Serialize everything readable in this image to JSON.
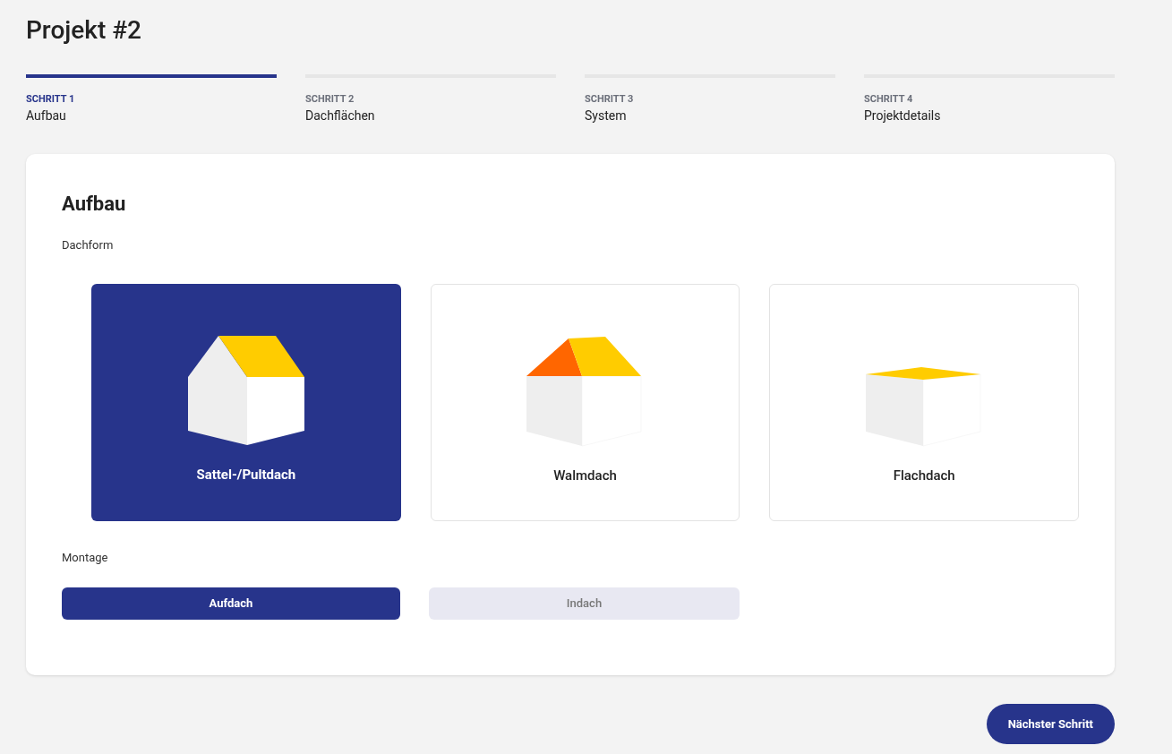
{
  "title": "Projekt #2",
  "steps": [
    {
      "label": "SCHRITT 1",
      "name": "Aufbau",
      "selected": true
    },
    {
      "label": "SCHRITT 2",
      "name": "Dachflächen",
      "selected": false
    },
    {
      "label": "SCHRITT 3",
      "name": "System",
      "selected": false
    },
    {
      "label": "SCHRITT 4",
      "name": "Projektdetails",
      "selected": false
    }
  ],
  "section": {
    "title": "Aufbau",
    "roof_label": "Dachform",
    "roofs": [
      {
        "kind": "sattel",
        "label": "Sattel-/Pultdach",
        "selected": true
      },
      {
        "kind": "walm",
        "label": "Walmdach",
        "selected": false
      },
      {
        "kind": "flach",
        "label": "Flachdach",
        "selected": false
      }
    ],
    "mount_label": "Montage",
    "mounts": [
      {
        "label": "Aufdach",
        "selected": true
      },
      {
        "label": "Indach",
        "selected": false
      }
    ]
  },
  "next_button": "Nächster Schritt"
}
